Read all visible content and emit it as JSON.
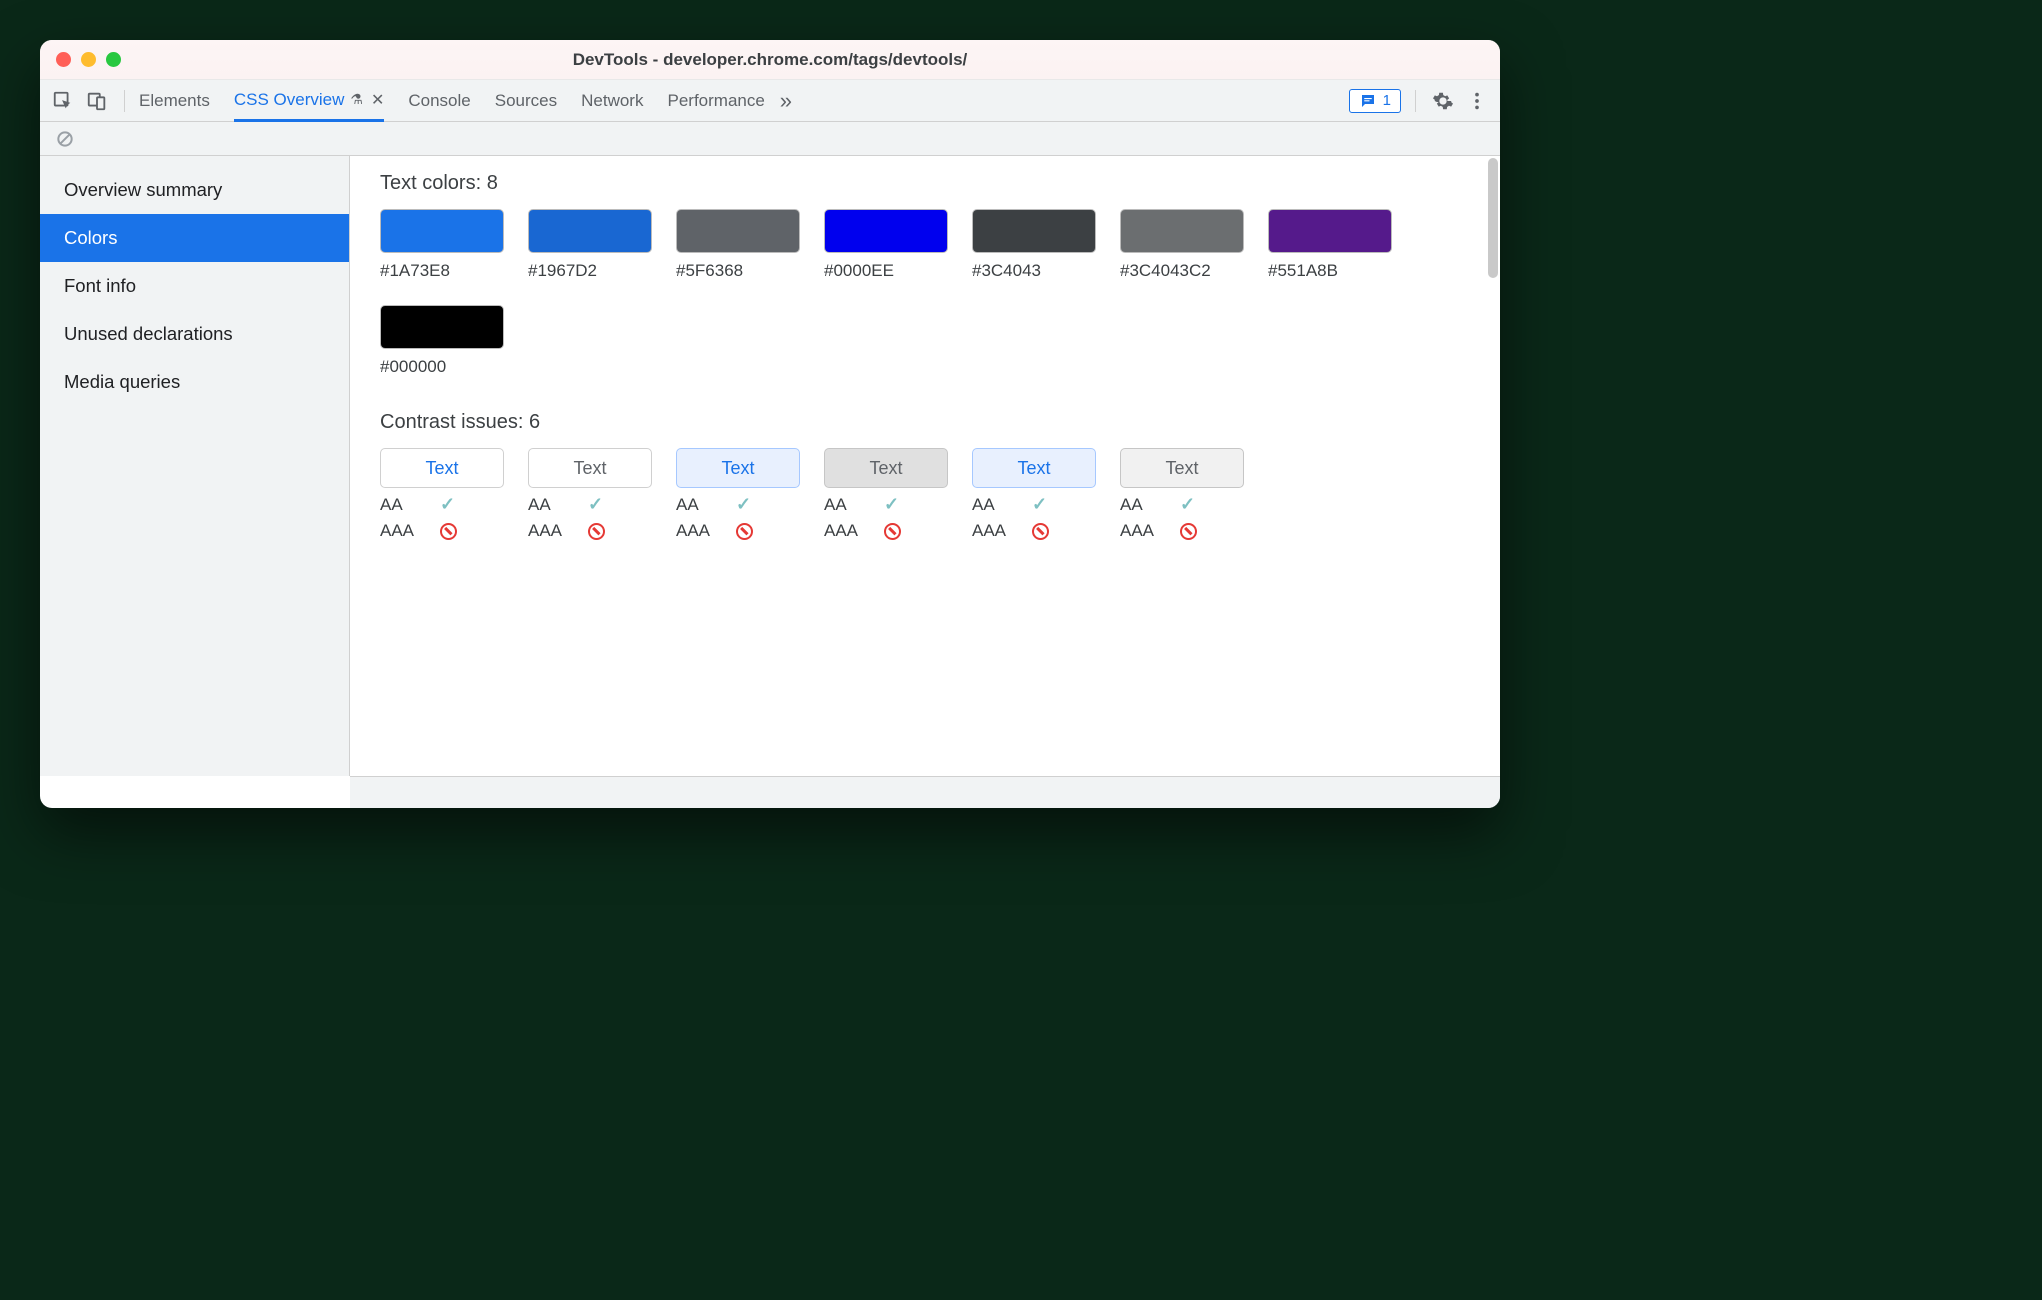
{
  "window": {
    "title": "DevTools - developer.chrome.com/tags/devtools/"
  },
  "tabs": {
    "items": [
      "Elements",
      "CSS Overview",
      "Console",
      "Sources",
      "Network",
      "Performance"
    ],
    "activeIndex": 1,
    "overflow": "»"
  },
  "messageCount": "1",
  "sidebar": {
    "items": [
      "Overview summary",
      "Colors",
      "Font info",
      "Unused declarations",
      "Media queries"
    ],
    "activeIndex": 1
  },
  "textColors": {
    "title": "Text colors: 8",
    "items": [
      {
        "hex": "#1A73E8",
        "css": "#1A73E8"
      },
      {
        "hex": "#1967D2",
        "css": "#1967D2"
      },
      {
        "hex": "#5F6368",
        "css": "#5F6368"
      },
      {
        "hex": "#0000EE",
        "css": "#0000EE"
      },
      {
        "hex": "#3C4043",
        "css": "#3C4043"
      },
      {
        "hex": "#3C4043C2",
        "css": "rgba(60,64,67,0.76)"
      },
      {
        "hex": "#551A8B",
        "css": "#551A8B"
      },
      {
        "hex": "#000000",
        "css": "#000000"
      }
    ]
  },
  "contrast": {
    "title": "Contrast issues: 6",
    "sampleText": "Text",
    "aaLabel": "AA",
    "aaaLabel": "AAA",
    "items": [
      {
        "bg": "#ffffff",
        "fg": "#1a73e8",
        "border": "#d0d0d0",
        "aa": true,
        "aaa": false
      },
      {
        "bg": "#ffffff",
        "fg": "#5f6368",
        "border": "#d0d0d0",
        "aa": true,
        "aaa": false
      },
      {
        "bg": "#e8f0fe",
        "fg": "#1a73e8",
        "border": "#a6c8ff",
        "aa": true,
        "aaa": false
      },
      {
        "bg": "#e0e0e0",
        "fg": "#5f6368",
        "border": "#c6c6c6",
        "aa": true,
        "aaa": false
      },
      {
        "bg": "#e8f0fe",
        "fg": "#1a73e8",
        "border": "#a6c8ff",
        "aa": true,
        "aaa": false
      },
      {
        "bg": "#f1f1f1",
        "fg": "#5f6368",
        "border": "#c6c6c6",
        "aa": true,
        "aaa": false
      }
    ]
  }
}
